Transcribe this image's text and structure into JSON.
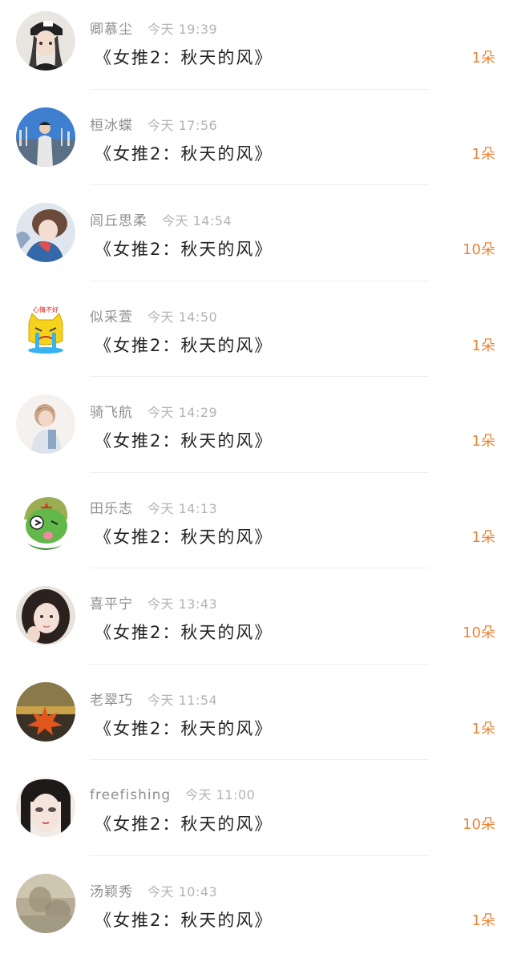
{
  "theme": {
    "accent": "#e8853a",
    "name_color": "#8f8f8f",
    "time_color": "#b3b3b3",
    "title_color": "#222222"
  },
  "items": [
    {
      "name": "卿慕尘",
      "time": "今天 19:39",
      "title": "《女推2：秋天的风》",
      "count": "1朵",
      "avatar": "avatar-girl-black-cap"
    },
    {
      "name": "桓冰蝶",
      "time": "今天 17:56",
      "title": "《女推2：秋天的风》",
      "count": "1朵",
      "avatar": "avatar-man-harbor"
    },
    {
      "name": "闾丘思柔",
      "time": "今天 14:54",
      "title": "《女推2：秋天的风》",
      "count": "10朵",
      "avatar": "avatar-anime-couple"
    },
    {
      "name": "似采萱",
      "time": "今天 14:50",
      "title": "《女推2：秋天的风》",
      "count": "1朵",
      "avatar": "avatar-crying-cat-sticker"
    },
    {
      "name": "骑飞航",
      "time": "今天 14:29",
      "title": "《女推2：秋天的风》",
      "count": "1朵",
      "avatar": "avatar-girl-photo"
    },
    {
      "name": "田乐志",
      "time": "今天 14:13",
      "title": "《女推2：秋天的风》",
      "count": "1朵",
      "avatar": "avatar-green-frog-cartoon"
    },
    {
      "name": "喜平宁",
      "time": "今天 13:43",
      "title": "《女推2：秋天的风》",
      "count": "10朵",
      "avatar": "avatar-girl-selfie"
    },
    {
      "name": "老翠巧",
      "time": "今天 11:54",
      "title": "《女推2：秋天的风》",
      "count": "1朵",
      "avatar": "avatar-autumn-leaf"
    },
    {
      "name": "freefishing",
      "time": "今天 11:00",
      "title": "《女推2：秋天的风》",
      "count": "10朵",
      "avatar": "avatar-anime-girl-face"
    },
    {
      "name": "汤颖秀",
      "time": "今天 10:43",
      "title": "《女推2：秋天的风》",
      "count": "1朵",
      "avatar": "avatar-vintage-tone"
    }
  ]
}
